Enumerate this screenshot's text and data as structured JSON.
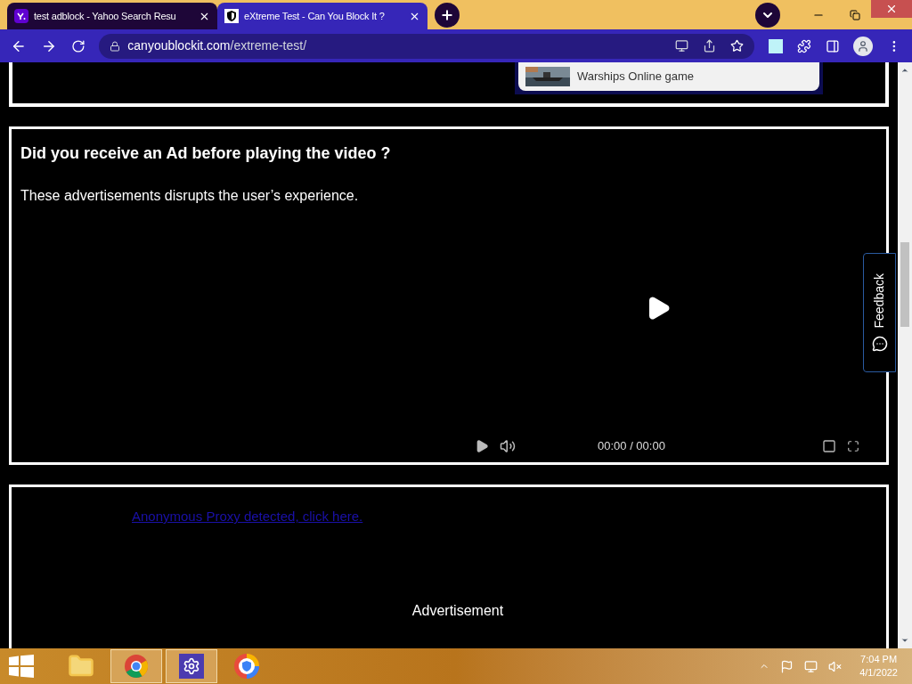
{
  "tabs": [
    {
      "title": "test adblock - Yahoo Search Resu",
      "selected": false,
      "kind": "yahoo"
    },
    {
      "title": "eXtreme Test - Can You Block It ?",
      "selected": true,
      "kind": "shield"
    }
  ],
  "address": {
    "domain": "canyoublockit.com",
    "path": "/extreme-test/"
  },
  "ad_card": {
    "text": "Warships Online game"
  },
  "video_section": {
    "title": "Did you receive an Ad before playing the video ?",
    "description": "These advertisements disrupts the user’s experience.",
    "time": "00:00 / 00:00"
  },
  "ad_section": {
    "link": "Anonymous Proxy detected, click here.",
    "label": "Advertisement"
  },
  "feedback": {
    "label": "Feedback"
  },
  "taskbar": {
    "apps": [
      {
        "kind": "explorer",
        "selected": false
      },
      {
        "kind": "chrome",
        "selected": true
      },
      {
        "kind": "settings",
        "selected": true
      },
      {
        "kind": "browser",
        "selected": false
      }
    ],
    "time": "7:04 PM",
    "date": "4/1/2022"
  }
}
